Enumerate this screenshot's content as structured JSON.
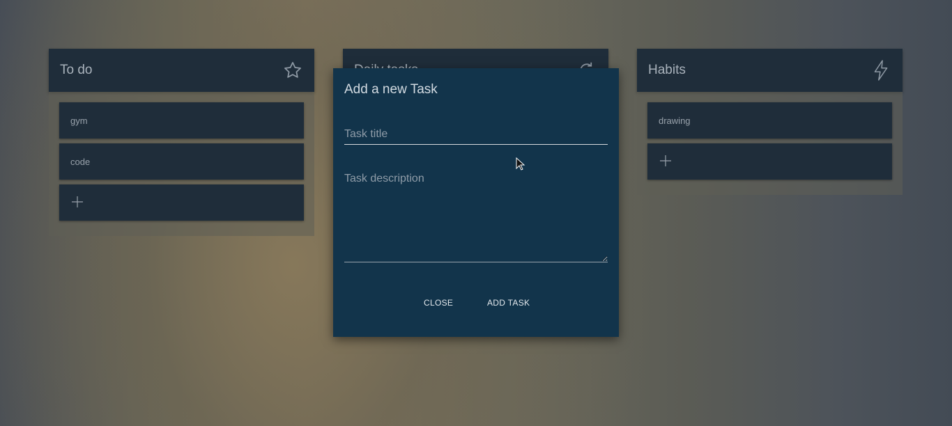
{
  "columns": [
    {
      "title": "To do",
      "icon": "star-icon",
      "cards": [
        "gym",
        "code"
      ],
      "add_label": "+"
    },
    {
      "title": "Daily tasks",
      "icon": "refresh-icon"
    },
    {
      "title": "Habits",
      "icon": "lightning-icon",
      "cards": [
        "drawing"
      ],
      "add_label": "+"
    }
  ],
  "modal": {
    "title": "Add a new Task",
    "title_placeholder": "Task title",
    "title_value": "",
    "description_placeholder": "Task description",
    "description_value": "",
    "close_label": "CLOSE",
    "add_label": "ADD TASK"
  },
  "colors": {
    "panel": "#1f2d3a",
    "modal": "#12344b",
    "text": "#a9b2bb"
  }
}
